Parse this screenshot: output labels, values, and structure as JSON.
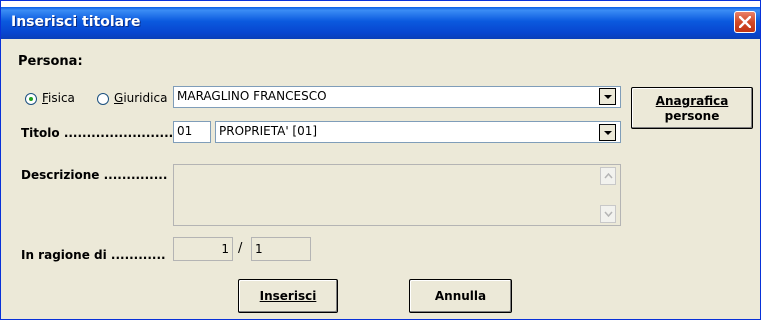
{
  "window": {
    "title": "Inserisci titolare",
    "close_icon": "close-icon"
  },
  "persona": {
    "label": "Persona:",
    "radio_fisica": {
      "label": "Fisica",
      "checked": true
    },
    "radio_giuridica": {
      "label": "Giuridica",
      "checked": false
    },
    "selected_value": "MARAGLINO FRANCESCO"
  },
  "anagrafica_button": {
    "line1": "Anagrafica",
    "line2": "persone"
  },
  "titolo": {
    "label": "Titolo ........................",
    "code": "01",
    "selected_value": "PROPRIETA' [01]"
  },
  "descrizione": {
    "label": "Descrizione ..............",
    "value": ""
  },
  "ragione": {
    "label": "In ragione di ............",
    "numerator": "1",
    "separator": "/",
    "denominator": "1"
  },
  "buttons": {
    "inserisci": "Inserisci",
    "annulla": "Annulla"
  }
}
